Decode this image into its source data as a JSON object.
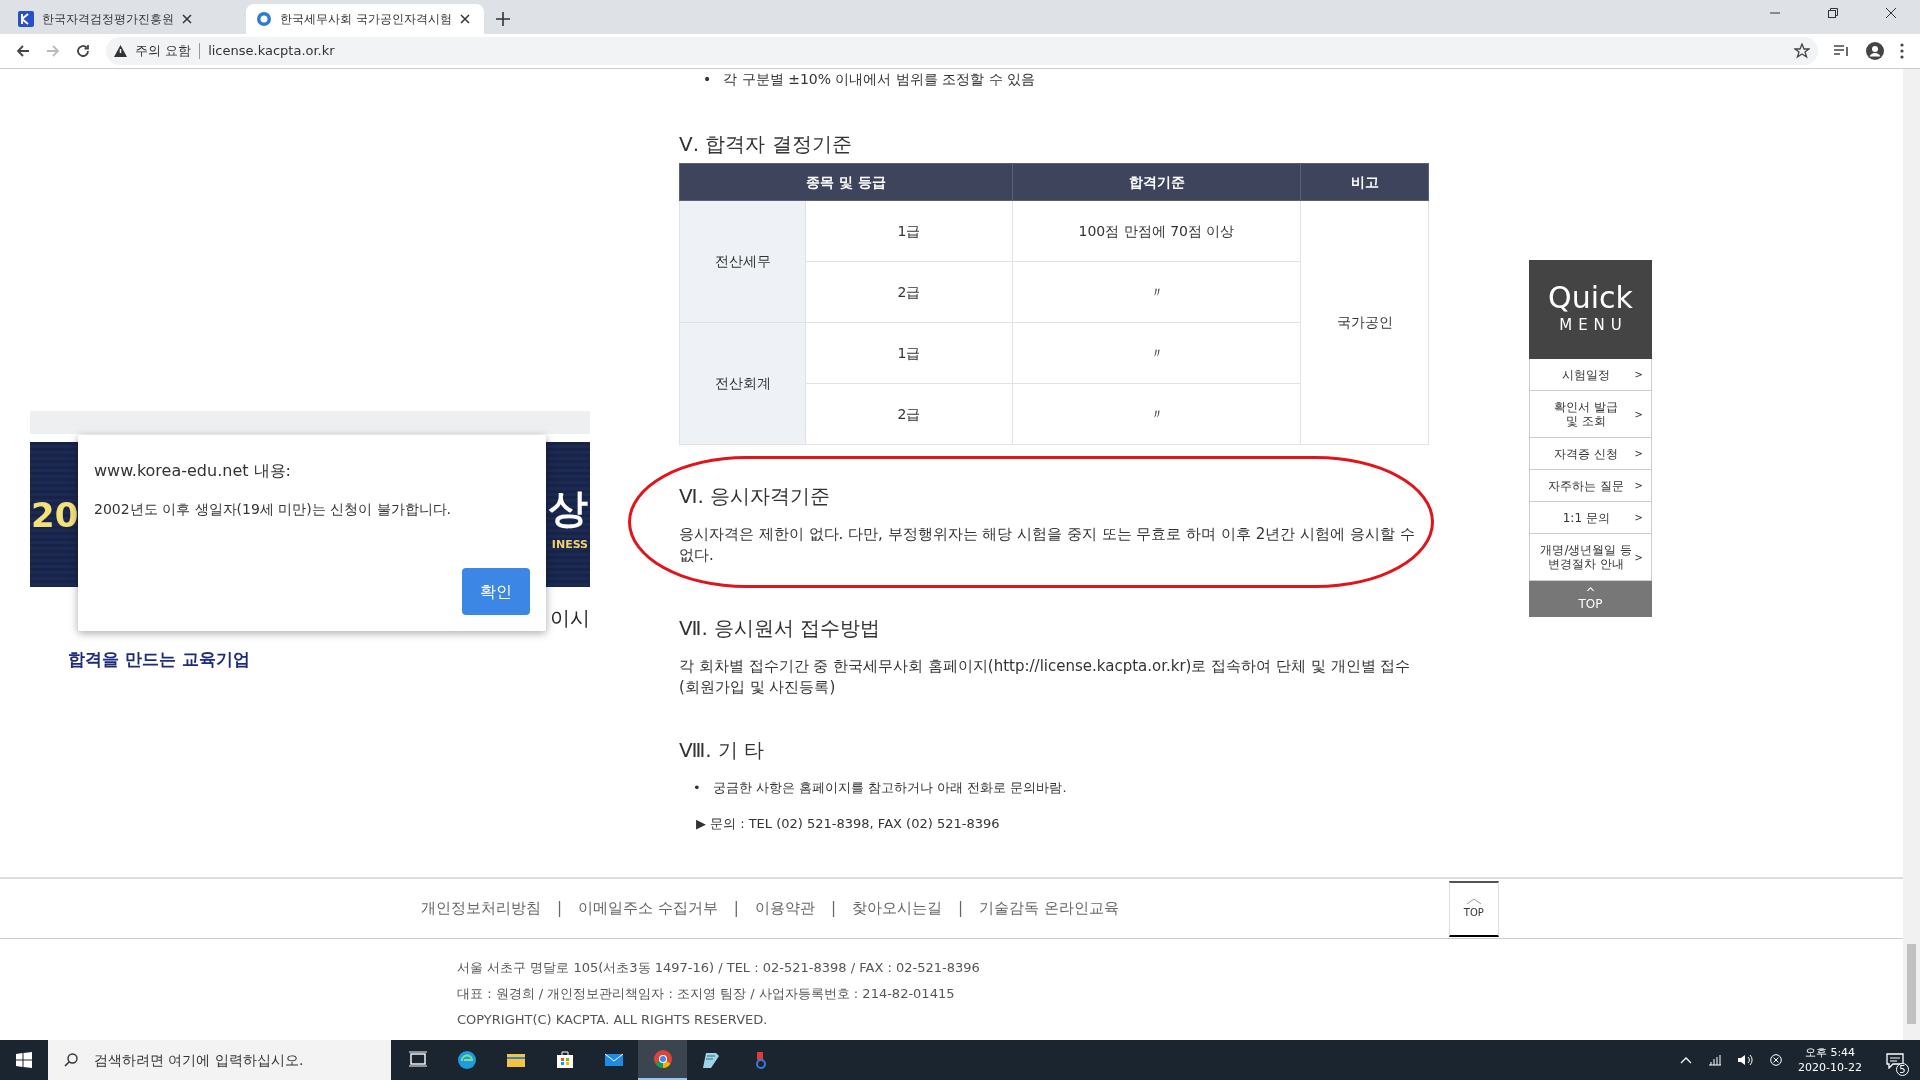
{
  "browser": {
    "tabs": [
      {
        "title": "한국자격검정평가진흥원",
        "selected": false
      },
      {
        "title": "한국세무사회 국가공인자격시험",
        "selected": true
      }
    ],
    "security_label": "주의 요함",
    "url": "license.kacpta.or.kr"
  },
  "left_panel": {
    "banner_texts": [
      "20",
      "상",
      "INESS"
    ],
    "tagline": "합격을 만드는 교육기업",
    "cut_text": "이시"
  },
  "dialog": {
    "title": "www.korea-edu.net 내용:",
    "message": "2002년도 이후 생일자(19세 미만)는 신청이 불가합니다.",
    "button": "확인"
  },
  "content": {
    "bullet_marker": "•",
    "top_bullet": "각 구분별 ±10% 이내에서 범위를 조정할 수 있음",
    "sections": [
      {
        "kind": "table",
        "heading": "Ⅴ. 합격자 결정기준",
        "highlighted": false,
        "table": {
          "columns": [
            "종목 및 등급",
            "합격기준",
            "비고"
          ],
          "remark": "국가공인",
          "groups": [
            {
              "subject": "전산세무",
              "grades": [
                {
                  "grade": "1급",
                  "criterion": "100점 만점에 70점 이상"
                },
                {
                  "grade": "2급",
                  "criterion": "〃"
                }
              ]
            },
            {
              "subject": "전산회계",
              "grades": [
                {
                  "grade": "1급",
                  "criterion": "〃"
                },
                {
                  "grade": "2급",
                  "criterion": "〃"
                }
              ]
            }
          ]
        }
      },
      {
        "kind": "paragraph",
        "heading": "Ⅵ. 응시자격기준",
        "highlighted": true,
        "text": "응시자격은 제한이 없다. 다만, 부정행위자는 해당 시험을 중지 또는 무효로 하며 이후 2년간 시험에 응시할 수 없다."
      },
      {
        "kind": "paragraph",
        "heading": "Ⅶ. 응시원서 접수방법",
        "highlighted": false,
        "text": "각 회차별 접수기간 중 한국세무사회 홈페이지(http://license.kacpta.or.kr)로 접속하여 단체 및 개인별 접수(회원가입 및 사진등록)"
      },
      {
        "kind": "list",
        "heading": "Ⅷ. 기 타",
        "highlighted": false,
        "bullets": [
          "궁금한 사항은 홈페이지를 참고하거나 아래 전화로 문의바람."
        ],
        "contact_marker": "▶",
        "contact": "문의 : TEL (02) 521-8398, FAX (02) 521-8396"
      }
    ]
  },
  "quick_menu": {
    "title": "Quick",
    "subtitle": "MENU",
    "items": [
      {
        "lines": [
          "시험일정"
        ],
        "arrow": ">"
      },
      {
        "lines": [
          "확인서 발급",
          "및 조회"
        ],
        "arrow": ">"
      },
      {
        "lines": [
          "자격증 신청"
        ],
        "arrow": ">"
      },
      {
        "lines": [
          "자주하는 질문"
        ],
        "arrow": ">"
      },
      {
        "lines": [
          "1:1 문의"
        ],
        "arrow": ">"
      },
      {
        "lines": [
          "개명/생년월일 등",
          "변경절차 안내"
        ],
        "arrow": ">"
      }
    ],
    "top_caret": "^",
    "top_label": "TOP"
  },
  "footer": {
    "links": [
      "개인정보처리방침",
      "이메일주소 수집거부",
      "이용약관",
      "찾아오시는길",
      "기술감독 온라인교육"
    ],
    "separator": "|",
    "top_label": "TOP",
    "address_lines": [
      "서울 서초구 명달로 105(서초3동 1497-16) / TEL : 02-521-8398 / FAX : 02-521-8396",
      "대표 : 원경희 / 개인정보관리책임자 : 조지영 팀장 / 사업자등록번호 : 214-82-01415",
      "COPYRIGHT(C) KACPTA.  ALL RIGHTS RESERVED."
    ]
  },
  "taskbar": {
    "search_placeholder": "검색하려면 여기에 입력하십시오.",
    "time": "오후 5:44",
    "date": "2020-10-22",
    "notification_count": "5"
  }
}
